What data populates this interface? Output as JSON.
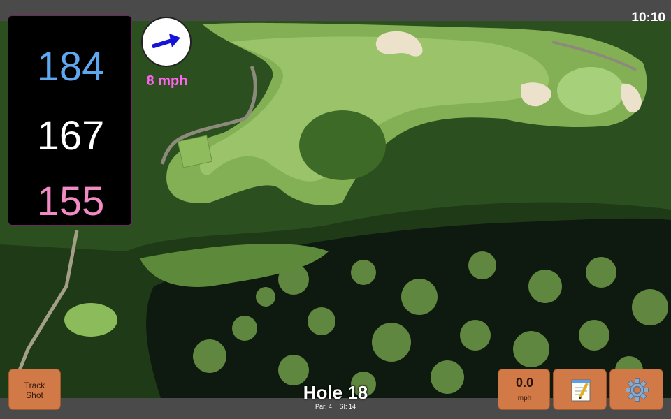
{
  "status_bar": {
    "time": "10:10"
  },
  "yardages": {
    "back": "184",
    "center": "167",
    "front": "155"
  },
  "wind": {
    "speed": "8 mph"
  },
  "buttons": {
    "track_shot": "Track\nShot",
    "speed_value": "0.0",
    "speed_unit": "mph"
  },
  "hole": {
    "title": "Hole 18",
    "par": "Par: 4",
    "si": "SI: 14"
  },
  "colors": {
    "back_yardage": "#5fa8f0",
    "center_yardage": "#ffffff",
    "front_yardage": "#f28ac4",
    "wind_text": "#ff63f0",
    "button": "#d17a47"
  },
  "icons": {
    "wind_arrow": "arrow-icon",
    "notes": "notepad-icon",
    "settings": "gear-icon"
  }
}
